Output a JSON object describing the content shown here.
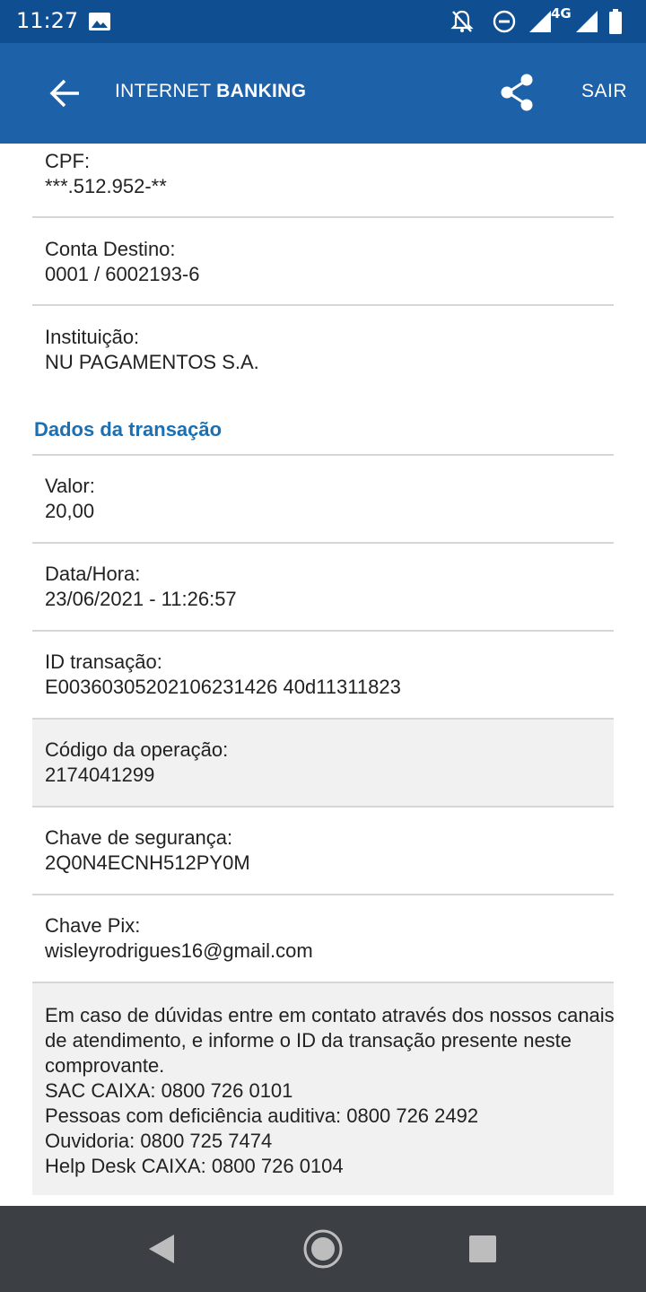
{
  "status_bar": {
    "time": "11:27",
    "network": "4G",
    "icons": [
      "image-icon",
      "bell-off-icon",
      "do-not-disturb-icon",
      "signal-icon",
      "signal-icon",
      "battery-icon"
    ]
  },
  "app_bar": {
    "title_part1": "INTERNET",
    "title_part2": "BANKING",
    "exit_label": "SAIR",
    "icons": [
      "back-arrow-icon",
      "share-icon"
    ]
  },
  "recipient": {
    "cpf_label": "CPF:",
    "cpf_value": "***.512.952-**",
    "account_label": "Conta Destino:",
    "account_value": "0001 / 6002193-6",
    "institution_label": "Instituição:",
    "institution_value": "NU PAGAMENTOS S.A."
  },
  "transaction": {
    "section_title": "Dados da transação",
    "fields": [
      {
        "label": "Valor:",
        "value": "20,00"
      },
      {
        "label": "Data/Hora:",
        "value": "23/06/2021 - 11:26:57"
      },
      {
        "label": "ID transação:",
        "value": "E00360305202106231426 40d11311823"
      },
      {
        "label": "Código da operação:",
        "value": "2174041299"
      },
      {
        "label": "Chave de segurança:",
        "value": "2Q0N4ECNH512PY0M"
      },
      {
        "label": "Chave Pix:",
        "value": "wisleyrodrigues16@gmail.com"
      }
    ]
  },
  "info": {
    "lines": [
      "Em caso de dúvidas entre em contato através dos nossos canais",
      "de atendimento, e informe o ID da transação presente neste",
      "comprovante.",
      "SAC CAIXA: 0800 726 0101",
      "Pessoas com deficiência auditiva: 0800 726 2492",
      "Ouvidoria: 0800 725 7474",
      "Help Desk CAIXA: 0800 726 0104"
    ]
  },
  "colors": {
    "status_bar": "#0f4f91",
    "app_bar": "#1d62a9",
    "section_title": "#1b70b3",
    "highlight_bg": "#f2f1f2",
    "nav_bar": "#3c4044"
  },
  "nav_bar": {
    "icons": [
      "back-triangle-icon",
      "home-circle-icon",
      "recents-square-icon"
    ]
  }
}
